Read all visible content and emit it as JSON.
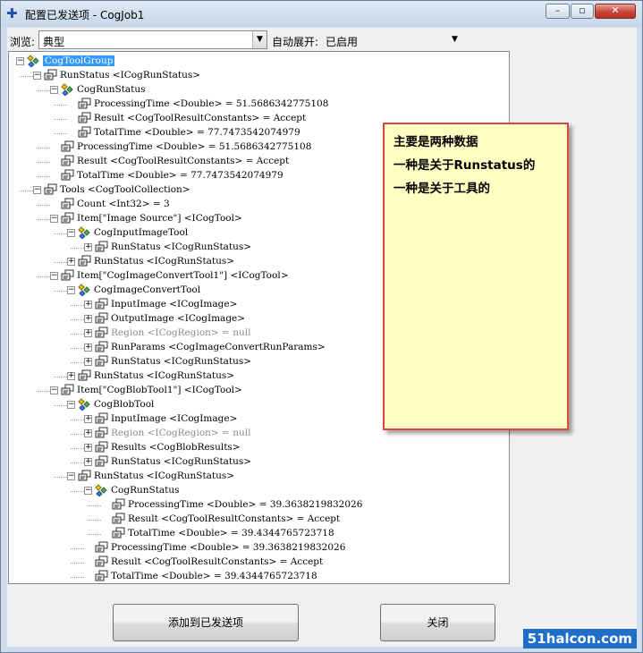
{
  "window": {
    "title": "配置已发送项 - CogJob1",
    "controls": {
      "minimize": "–",
      "maximize": "▫",
      "close": "✕"
    }
  },
  "toolbar": {
    "browse_label": "浏览:",
    "browse_value": "典型",
    "auto_expand_label": "自动展开:",
    "auto_expand_value": "已启用"
  },
  "tree": {
    "nodes": [
      {
        "text": "CogToolGroup",
        "selected": true
      },
      {
        "text": "RunStatus <ICogRunStatus>"
      },
      {
        "text": "CogRunStatus"
      },
      {
        "text": "ProcessingTime <Double> = 51.5686342775108"
      },
      {
        "text": "Result <CogToolResultConstants> = Accept"
      },
      {
        "text": "TotalTime <Double> = 77.7473542074979"
      },
      {
        "text": "ProcessingTime <Double> = 51.5686342775108"
      },
      {
        "text": "Result <CogToolResultConstants> = Accept"
      },
      {
        "text": "TotalTime <Double> = 77.7473542074979"
      },
      {
        "text": "Tools <CogToolCollection>"
      },
      {
        "text": "Count <Int32> = 3"
      },
      {
        "text": "Item[\"Image Source\"] <ICogTool>"
      },
      {
        "text": "CogInputImageTool"
      },
      {
        "text": "RunStatus <ICogRunStatus>"
      },
      {
        "text": "RunStatus <ICogRunStatus>"
      },
      {
        "text": "Item[\"CogImageConvertTool1\"] <ICogTool>"
      },
      {
        "text": "CogImageConvertTool"
      },
      {
        "text": "InputImage <ICogImage>"
      },
      {
        "text": "OutputImage <ICogImage>"
      },
      {
        "text": "Region <ICogRegion> = null",
        "dim": true
      },
      {
        "text": "RunParams <CogImageConvertRunParams>"
      },
      {
        "text": "RunStatus <ICogRunStatus>"
      },
      {
        "text": "RunStatus <ICogRunStatus>"
      },
      {
        "text": "Item[\"CogBlobTool1\"] <ICogTool>"
      },
      {
        "text": "CogBlobTool"
      },
      {
        "text": "InputImage <ICogImage>"
      },
      {
        "text": "Region <ICogRegion> = null",
        "dim": true
      },
      {
        "text": "Results <CogBlobResults>"
      },
      {
        "text": "RunStatus <ICogRunStatus>"
      },
      {
        "text": "RunStatus <ICogRunStatus>"
      },
      {
        "text": "CogRunStatus"
      },
      {
        "text": "ProcessingTime <Double> = 39.3638219832026"
      },
      {
        "text": "Result <CogToolResultConstants> = Accept"
      },
      {
        "text": "TotalTime <Double> = 39.4344765723718"
      },
      {
        "text": "ProcessingTime <Double> = 39.3638219832026"
      },
      {
        "text": "Result <CogToolResultConstants> = Accept"
      },
      {
        "text": "TotalTime <Double> = 39.4344765723718"
      }
    ]
  },
  "note": {
    "lines": [
      "主要是两种数据",
      "一种是关于Runstatus的",
      "一种是关于工具的"
    ]
  },
  "buttons": {
    "add": "添加到已发送项",
    "close": "关闭"
  },
  "watermark": "51halcon.com",
  "colors": {
    "selection": "#3399ff",
    "note_bg": "#ffffc2",
    "note_border": "#dd4444"
  }
}
